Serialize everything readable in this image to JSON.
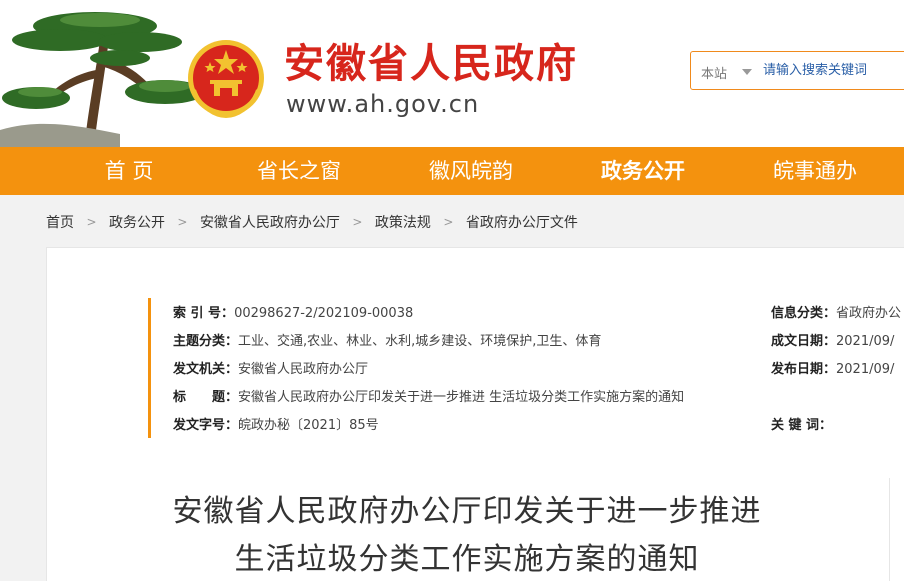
{
  "header": {
    "site_title": "安徽省人民政府",
    "site_url": "www.ah.gov.cn",
    "search": {
      "scope": "本站",
      "placeholder": "请输入搜索关键词"
    }
  },
  "nav": {
    "items": [
      {
        "label": "首 页"
      },
      {
        "label": "省长之窗"
      },
      {
        "label": "徽风皖韵"
      },
      {
        "label": "政务公开"
      },
      {
        "label": "皖事通办"
      }
    ],
    "active_index": 3
  },
  "breadcrumb": [
    "首页",
    "政务公开",
    "安徽省人民政府办公厅",
    "政策法规",
    "省政府办公厅文件"
  ],
  "meta": {
    "index_label": "索 引 号：",
    "index_value": "00298627-2/202109-00038",
    "topic_label": "主题分类：",
    "topic_value": "工业、交通,农业、林业、水利,城乡建设、环境保护,卫生、体育",
    "issuer_label": "发文机关：",
    "issuer_value": "安徽省人民政府办公厅",
    "title_label": "标　　题：",
    "title_value": "安徽省人民政府办公厅印发关于进一步推进 生活垃圾分类工作实施方案的通知",
    "docno_label": "发文字号：",
    "docno_value": "皖政办秘〔2021〕85号",
    "category_label": "信息分类：",
    "category_value": "省政府办公",
    "created_label": "成文日期：",
    "created_value": "2021/09/",
    "published_label": "发布日期：",
    "published_value": "2021/09/",
    "keywords_label": "关 键 词："
  },
  "article": {
    "title_line1": "安徽省人民政府办公厅印发关于进一步推进",
    "title_line2": "生活垃圾分类工作实施方案的通知"
  },
  "colors": {
    "brand_red": "#d7261c",
    "nav_orange": "#f4920e",
    "link_blue": "#2a5fa7"
  }
}
